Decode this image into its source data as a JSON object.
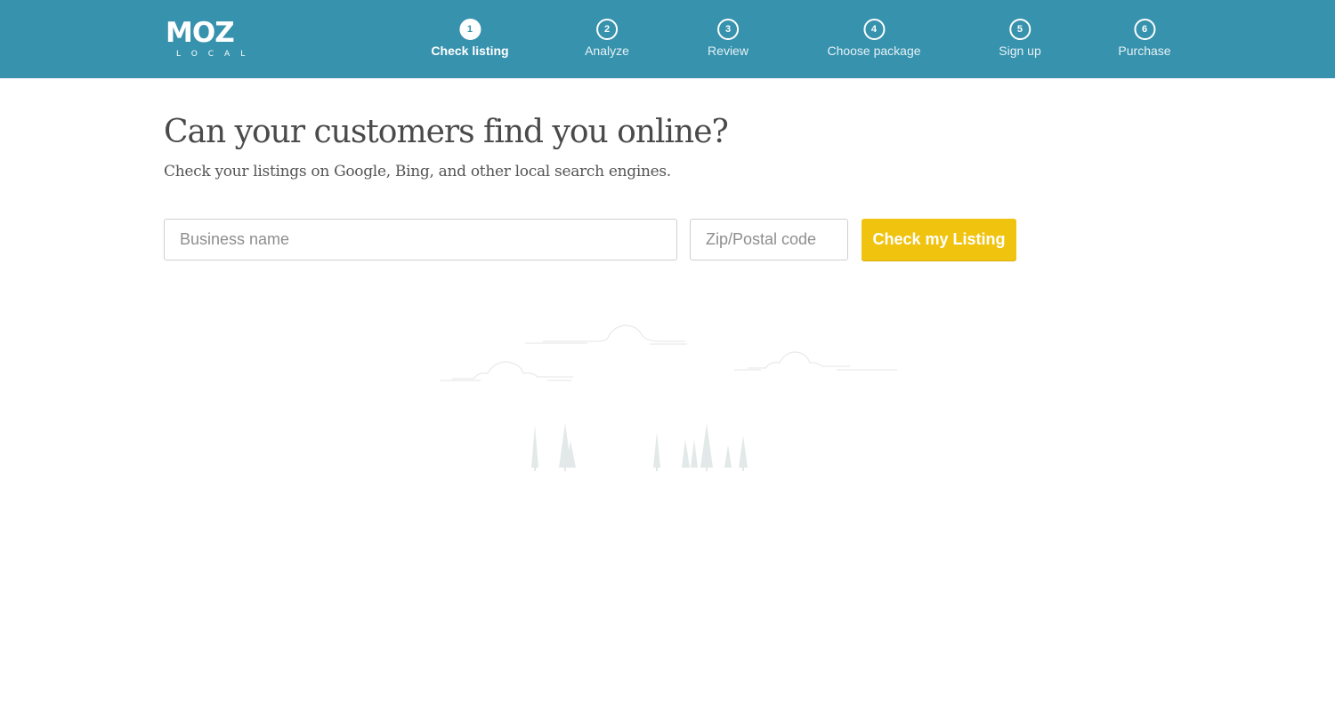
{
  "brand": {
    "name": "MOZ",
    "product": "LOCAL",
    "primary_color": "#3792ad",
    "accent_color": "#f0c30f"
  },
  "steps": [
    {
      "number": "1",
      "label": "Check listing",
      "active": true
    },
    {
      "number": "2",
      "label": "Analyze",
      "active": false
    },
    {
      "number": "3",
      "label": "Review",
      "active": false
    },
    {
      "number": "4",
      "label": "Choose package",
      "active": false
    },
    {
      "number": "5",
      "label": "Sign up",
      "active": false
    },
    {
      "number": "6",
      "label": "Purchase",
      "active": false
    }
  ],
  "main": {
    "title": "Can your customers find you online?",
    "subtitle": "Check your listings on Google, Bing, and other local search engines.",
    "form": {
      "business_name": {
        "value": "",
        "placeholder": "Business name"
      },
      "zip": {
        "value": "",
        "placeholder": "Zip/Postal code"
      },
      "submit_label": "Check my Listing"
    }
  },
  "illustration": {
    "description": "landscape with clouds and trees",
    "elements": [
      "cloud",
      "cloud",
      "cloud",
      "tree",
      "tree",
      "tree",
      "tree",
      "tree",
      "tree",
      "tree",
      "tree",
      "tree"
    ]
  }
}
